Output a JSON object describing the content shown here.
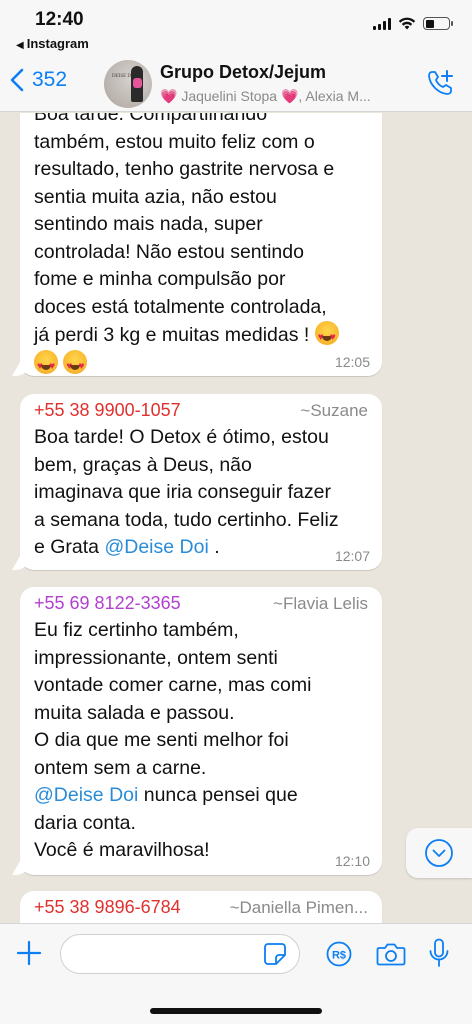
{
  "status": {
    "time": "12:40",
    "back_app": "Instagram"
  },
  "header": {
    "back_count": "352",
    "group_name": "Grupo Detox/Jejum",
    "members": "Jaquelini Stopa",
    "members_more": ", Alexia M..."
  },
  "messages": [
    {
      "lines": [
        "Boa tarde. Compartilhando",
        "também, estou muito feliz com o",
        "resultado, tenho gastrite nervosa e",
        "sentia muita azia, não estou",
        "sentindo mais nada, super",
        "controlada! Não estou sentindo",
        "fome e minha compulsão por",
        "doces está totalmente controlada,",
        "já perdi 3 kg e muitas medidas !"
      ],
      "time": "12:05",
      "emoji": "heart-eyes-emoji"
    },
    {
      "sender": "+55 38 9900-1057",
      "alias": "~Suzane",
      "sender_color": "#e0312e",
      "lines": [
        "Boa tarde! O Detox é ótimo, estou",
        "bem, graças à Deus, não",
        "imaginava que iria conseguir fazer",
        "a semana toda, tudo certinho. Feliz"
      ],
      "last_prefix": "e Grata ",
      "mention": "@Deise Doi",
      "last_suffix": " .",
      "time": "12:07"
    },
    {
      "sender": "+55 69 8122-3365",
      "alias": "~Flavia Lelis",
      "sender_color": "#b23fcf",
      "lines": [
        "Eu fiz certinho também,",
        "impressionante, ontem senti",
        "vontade comer carne, mas comi",
        "muita salada e passou.",
        "O dia que me senti melhor foi",
        "ontem sem a carne."
      ],
      "mention": "@Deise Doi",
      "mention_suffix": " nunca pensei que",
      "lines_after": [
        "daria conta.",
        "Você é maravilhosa!"
      ],
      "time": "12:10"
    },
    {
      "sender": "+55 38 9896-6784",
      "alias": "~Daniella Pimen...",
      "sender_color": "#e0312e"
    }
  ],
  "colors": {
    "accent": "#0b7ff3",
    "mention": "#2a8cd8",
    "chat_bg": "#e9e4dc"
  }
}
